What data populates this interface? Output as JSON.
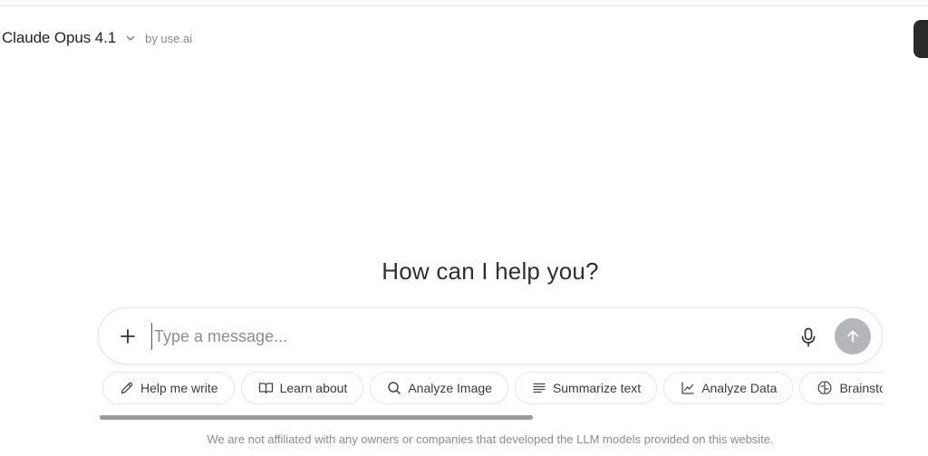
{
  "header": {
    "model_name": "Claude Opus 4.1",
    "provider_text": "by use.ai"
  },
  "greeting": "How can I help you?",
  "composer": {
    "placeholder": "Type a message...",
    "value": ""
  },
  "chips": [
    {
      "label": "Help me write",
      "icon": "pencil-icon"
    },
    {
      "label": "Learn about",
      "icon": "book-icon"
    },
    {
      "label": "Analyze Image",
      "icon": "magnify-icon"
    },
    {
      "label": "Summarize text",
      "icon": "lines-icon"
    },
    {
      "label": "Analyze Data",
      "icon": "line-chart-icon"
    },
    {
      "label": "Brainstorm",
      "icon": "brain-icon"
    }
  ],
  "disclaimer": "We are not affiliated with any owners or companies that developed the LLM models provided on this website.",
  "colors": {
    "send_button": "#b4b6ba",
    "right_tab": "#2b2b2b",
    "scrollbar": "#9a9a9a"
  }
}
